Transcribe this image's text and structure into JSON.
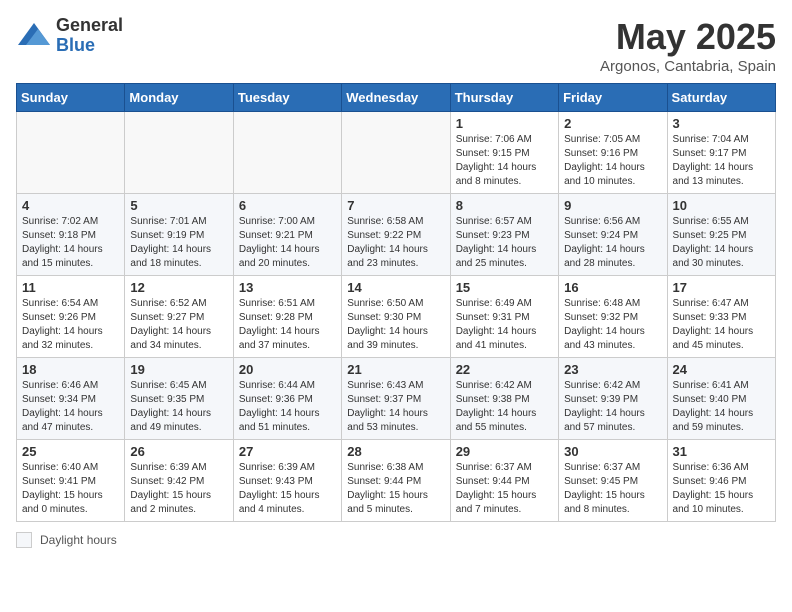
{
  "logo": {
    "general": "General",
    "blue": "Blue"
  },
  "title": "May 2025",
  "subtitle": "Argonos, Cantabria, Spain",
  "weekdays": [
    "Sunday",
    "Monday",
    "Tuesday",
    "Wednesday",
    "Thursday",
    "Friday",
    "Saturday"
  ],
  "legend": {
    "label": "Daylight hours"
  },
  "weeks": [
    [
      {
        "day": "",
        "info": ""
      },
      {
        "day": "",
        "info": ""
      },
      {
        "day": "",
        "info": ""
      },
      {
        "day": "",
        "info": ""
      },
      {
        "day": "1",
        "info": "Sunrise: 7:06 AM\nSunset: 9:15 PM\nDaylight: 14 hours\nand 8 minutes."
      },
      {
        "day": "2",
        "info": "Sunrise: 7:05 AM\nSunset: 9:16 PM\nDaylight: 14 hours\nand 10 minutes."
      },
      {
        "day": "3",
        "info": "Sunrise: 7:04 AM\nSunset: 9:17 PM\nDaylight: 14 hours\nand 13 minutes."
      }
    ],
    [
      {
        "day": "4",
        "info": "Sunrise: 7:02 AM\nSunset: 9:18 PM\nDaylight: 14 hours\nand 15 minutes."
      },
      {
        "day": "5",
        "info": "Sunrise: 7:01 AM\nSunset: 9:19 PM\nDaylight: 14 hours\nand 18 minutes."
      },
      {
        "day": "6",
        "info": "Sunrise: 7:00 AM\nSunset: 9:21 PM\nDaylight: 14 hours\nand 20 minutes."
      },
      {
        "day": "7",
        "info": "Sunrise: 6:58 AM\nSunset: 9:22 PM\nDaylight: 14 hours\nand 23 minutes."
      },
      {
        "day": "8",
        "info": "Sunrise: 6:57 AM\nSunset: 9:23 PM\nDaylight: 14 hours\nand 25 minutes."
      },
      {
        "day": "9",
        "info": "Sunrise: 6:56 AM\nSunset: 9:24 PM\nDaylight: 14 hours\nand 28 minutes."
      },
      {
        "day": "10",
        "info": "Sunrise: 6:55 AM\nSunset: 9:25 PM\nDaylight: 14 hours\nand 30 minutes."
      }
    ],
    [
      {
        "day": "11",
        "info": "Sunrise: 6:54 AM\nSunset: 9:26 PM\nDaylight: 14 hours\nand 32 minutes."
      },
      {
        "day": "12",
        "info": "Sunrise: 6:52 AM\nSunset: 9:27 PM\nDaylight: 14 hours\nand 34 minutes."
      },
      {
        "day": "13",
        "info": "Sunrise: 6:51 AM\nSunset: 9:28 PM\nDaylight: 14 hours\nand 37 minutes."
      },
      {
        "day": "14",
        "info": "Sunrise: 6:50 AM\nSunset: 9:30 PM\nDaylight: 14 hours\nand 39 minutes."
      },
      {
        "day": "15",
        "info": "Sunrise: 6:49 AM\nSunset: 9:31 PM\nDaylight: 14 hours\nand 41 minutes."
      },
      {
        "day": "16",
        "info": "Sunrise: 6:48 AM\nSunset: 9:32 PM\nDaylight: 14 hours\nand 43 minutes."
      },
      {
        "day": "17",
        "info": "Sunrise: 6:47 AM\nSunset: 9:33 PM\nDaylight: 14 hours\nand 45 minutes."
      }
    ],
    [
      {
        "day": "18",
        "info": "Sunrise: 6:46 AM\nSunset: 9:34 PM\nDaylight: 14 hours\nand 47 minutes."
      },
      {
        "day": "19",
        "info": "Sunrise: 6:45 AM\nSunset: 9:35 PM\nDaylight: 14 hours\nand 49 minutes."
      },
      {
        "day": "20",
        "info": "Sunrise: 6:44 AM\nSunset: 9:36 PM\nDaylight: 14 hours\nand 51 minutes."
      },
      {
        "day": "21",
        "info": "Sunrise: 6:43 AM\nSunset: 9:37 PM\nDaylight: 14 hours\nand 53 minutes."
      },
      {
        "day": "22",
        "info": "Sunrise: 6:42 AM\nSunset: 9:38 PM\nDaylight: 14 hours\nand 55 minutes."
      },
      {
        "day": "23",
        "info": "Sunrise: 6:42 AM\nSunset: 9:39 PM\nDaylight: 14 hours\nand 57 minutes."
      },
      {
        "day": "24",
        "info": "Sunrise: 6:41 AM\nSunset: 9:40 PM\nDaylight: 14 hours\nand 59 minutes."
      }
    ],
    [
      {
        "day": "25",
        "info": "Sunrise: 6:40 AM\nSunset: 9:41 PM\nDaylight: 15 hours\nand 0 minutes."
      },
      {
        "day": "26",
        "info": "Sunrise: 6:39 AM\nSunset: 9:42 PM\nDaylight: 15 hours\nand 2 minutes."
      },
      {
        "day": "27",
        "info": "Sunrise: 6:39 AM\nSunset: 9:43 PM\nDaylight: 15 hours\nand 4 minutes."
      },
      {
        "day": "28",
        "info": "Sunrise: 6:38 AM\nSunset: 9:44 PM\nDaylight: 15 hours\nand 5 minutes."
      },
      {
        "day": "29",
        "info": "Sunrise: 6:37 AM\nSunset: 9:44 PM\nDaylight: 15 hours\nand 7 minutes."
      },
      {
        "day": "30",
        "info": "Sunrise: 6:37 AM\nSunset: 9:45 PM\nDaylight: 15 hours\nand 8 minutes."
      },
      {
        "day": "31",
        "info": "Sunrise: 6:36 AM\nSunset: 9:46 PM\nDaylight: 15 hours\nand 10 minutes."
      }
    ]
  ]
}
